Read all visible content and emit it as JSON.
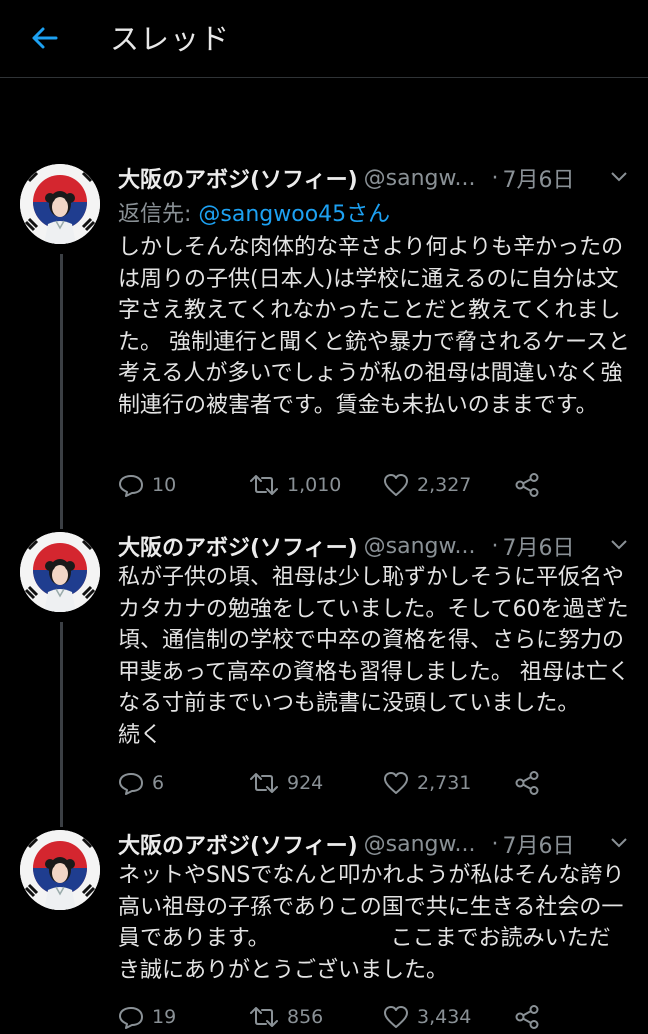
{
  "header": {
    "title": "スレッド",
    "back_icon": "arrow-left-icon"
  },
  "colors": {
    "accent": "#1da1f2",
    "background": "#000000",
    "muted": "#8a9196",
    "thread_line": "#3b3f44"
  },
  "tweets": [
    {
      "name": "大阪のアボジ(ソフィー)",
      "handle": "@sangw...",
      "date": "7月6日",
      "reply_prefix": "返信先: ",
      "reply_handle": "@sangwoo45さん",
      "text": "しかしそんな肉体的な辛さより何よりも辛かったのは周りの子供(日本人)は学校に通えるのに自分は文字さえ教えてくれなかったことだと教えてくれました。 強制連行と聞くと銃や暴力で脅されるケースと考える人が多いでしょうが私の祖母は間違いなく強制連行の被害者です。賃金も未払いのままです。",
      "replies": "10",
      "retweets": "1,010",
      "likes": "2,327"
    },
    {
      "name": "大阪のアボジ(ソフィー)",
      "handle": "@sangw...",
      "date": "7月6日",
      "text": "私が子供の頃、祖母は少し恥ずかしそうに平仮名やカタカナの勉強をしていました。そして60を過ぎた頃、通信制の学校で中卒の資格を得、さらに努力の甲斐あって高卒の資格も習得しました。 祖母は亡くなる寸前までいつも読書に没頭していました。　　　続く",
      "replies": "6",
      "retweets": "924",
      "likes": "2,731"
    },
    {
      "name": "大阪のアボジ(ソフィー)",
      "handle": "@sangw...",
      "date": "7月6日",
      "text": "ネットやSNSでなんと叩かれようが私はそんな誇り高い祖母の子孫でありこの国で共に生きる社会の一員であります。　　　　　　ここまでお読みいただき誠にありがとうございました。",
      "replies": "19",
      "retweets": "856",
      "likes": "3,434"
    }
  ]
}
